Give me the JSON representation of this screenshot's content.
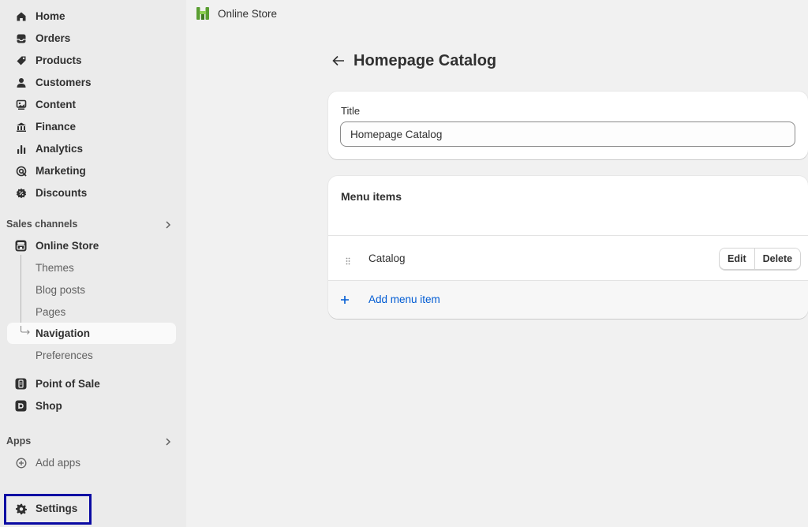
{
  "sidebar": {
    "main_items": [
      {
        "label": "Home",
        "icon": "home-icon"
      },
      {
        "label": "Orders",
        "icon": "inbox-icon"
      },
      {
        "label": "Products",
        "icon": "tag-icon"
      },
      {
        "label": "Customers",
        "icon": "person-icon"
      },
      {
        "label": "Content",
        "icon": "image-icon"
      },
      {
        "label": "Finance",
        "icon": "bank-icon"
      },
      {
        "label": "Analytics",
        "icon": "bar-chart-icon"
      },
      {
        "label": "Marketing",
        "icon": "target-icon"
      },
      {
        "label": "Discounts",
        "icon": "discount-icon"
      }
    ],
    "sales_channels_label": "Sales channels",
    "online_store_label": "Online Store",
    "online_store_sub": [
      "Themes",
      "Blog posts",
      "Pages",
      "Navigation",
      "Preferences"
    ],
    "active_sub": "Navigation",
    "pos_label": "Point of Sale",
    "shop_label": "Shop",
    "apps_label": "Apps",
    "add_apps_label": "Add apps",
    "settings_label": "Settings",
    "highlight_color": "#0a0aa3"
  },
  "topbar": {
    "title": "Online Store"
  },
  "page": {
    "title": "Homepage Catalog",
    "title_field": {
      "label": "Title",
      "value": "Homepage Catalog"
    },
    "menu_items": {
      "heading": "Menu items",
      "items": [
        {
          "label": "Catalog",
          "edit_label": "Edit",
          "delete_label": "Delete"
        }
      ],
      "add_label": "Add menu item"
    }
  },
  "colors": {
    "link": "#005bd3",
    "sidebar_bg": "#ebebeb",
    "page_bg": "#f1f1f1",
    "brand_green": "#5a9e32"
  }
}
